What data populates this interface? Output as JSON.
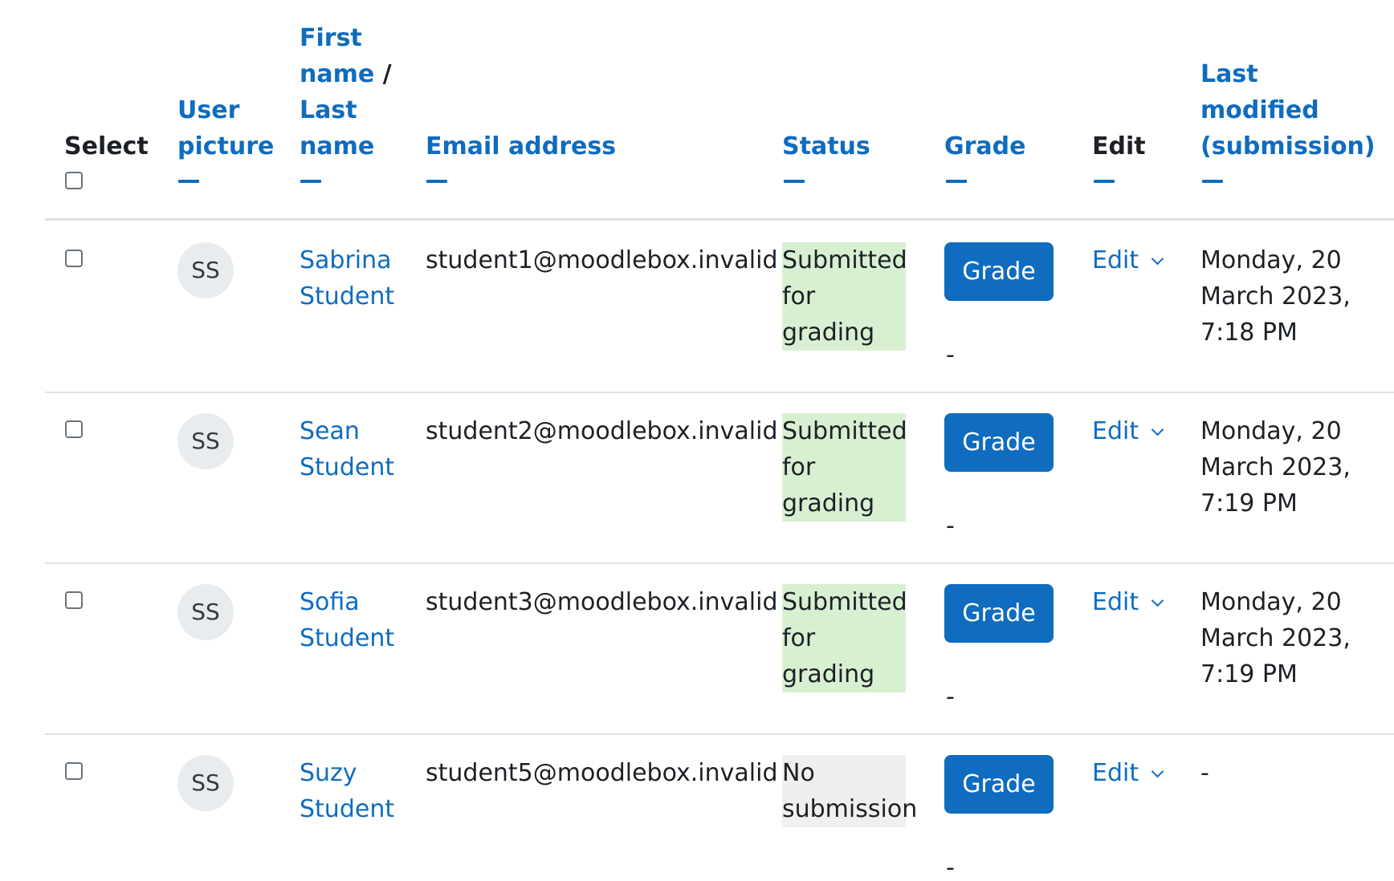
{
  "headers": {
    "select": "Select",
    "user_picture": [
      "User",
      "picture"
    ],
    "name_first": [
      "First",
      "name"
    ],
    "name_sep": "/",
    "name_last": [
      "Last",
      "name"
    ],
    "email": "Email address",
    "status": "Status",
    "grade": "Grade",
    "edit": "Edit",
    "last_modified": [
      "Last",
      "modified",
      "(submission)"
    ]
  },
  "rows": [
    {
      "initials": "SS",
      "first_name": "Sabrina",
      "last_name": "Student",
      "email": "student1@moodlebox.invalid",
      "status": [
        "Submitted",
        "for grading"
      ],
      "grade_button": "Grade",
      "grade_value": "-",
      "edit": "Edit",
      "modified": [
        "Monday, 20",
        "March 2023,",
        "7:18 PM"
      ]
    },
    {
      "initials": "SS",
      "first_name": "Sean",
      "last_name": "Student",
      "email": "student2@moodlebox.invalid",
      "status": [
        "Submitted",
        "for grading"
      ],
      "grade_button": "Grade",
      "grade_value": "-",
      "edit": "Edit",
      "modified": [
        "Monday, 20",
        "March 2023,",
        "7:19 PM"
      ]
    },
    {
      "initials": "SS",
      "first_name": "Sofia",
      "last_name": "Student",
      "email": "student3@moodlebox.invalid",
      "status": [
        "Submitted",
        "for grading"
      ],
      "grade_button": "Grade",
      "grade_value": "-",
      "edit": "Edit",
      "modified": [
        "Monday, 20",
        "March 2023,",
        "7:19 PM"
      ]
    },
    {
      "initials": "SS",
      "first_name": "Suzy",
      "last_name": "Student",
      "email": "student5@moodlebox.invalid",
      "status": [
        "No",
        "submission"
      ],
      "grade_button": "Grade",
      "grade_value": "-",
      "edit": "Edit",
      "modified": [
        "-"
      ]
    }
  ],
  "colors": {
    "link": "#0f6cbf",
    "submitted_bg": "#d7f0d2",
    "no_submission_bg": "#efefef",
    "button_bg": "#0f6cbf"
  },
  "icons": {
    "sort": "sort-dash-icon",
    "edit_menu": "chevron-down-icon"
  }
}
